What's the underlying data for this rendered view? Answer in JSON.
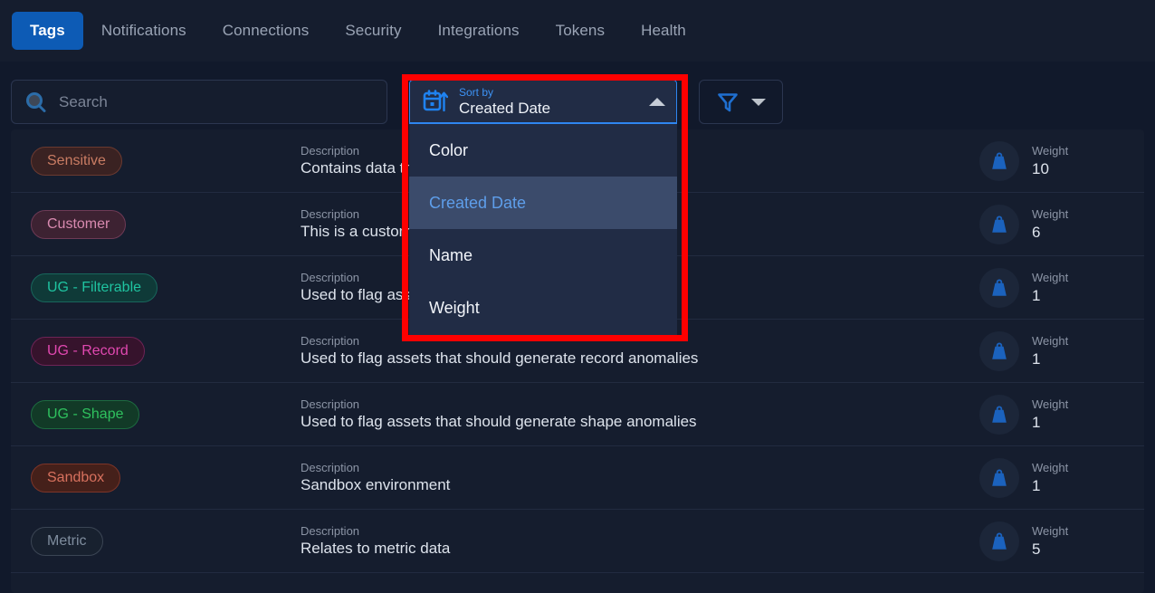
{
  "tabs": [
    {
      "label": "Tags",
      "active": true
    },
    {
      "label": "Notifications",
      "active": false
    },
    {
      "label": "Connections",
      "active": false
    },
    {
      "label": "Security",
      "active": false
    },
    {
      "label": "Integrations",
      "active": false
    },
    {
      "label": "Tokens",
      "active": false
    },
    {
      "label": "Health",
      "active": false
    }
  ],
  "search": {
    "placeholder": "Search",
    "value": ""
  },
  "sort": {
    "caption": "Sort by",
    "value": "Created Date",
    "expanded": true,
    "options": [
      {
        "label": "Color",
        "selected": false
      },
      {
        "label": "Created Date",
        "selected": true
      },
      {
        "label": "Name",
        "selected": false
      },
      {
        "label": "Weight",
        "selected": false
      }
    ]
  },
  "filter": {
    "label": ""
  },
  "columns": {
    "description": "Description",
    "weight": "Weight"
  },
  "rows": [
    {
      "tag": "Sensitive",
      "tag_color": "#c97c63",
      "tag_bg": "#3a2222",
      "tag_border": "#6b3a30",
      "description": "Contains data that requires strict access controls.",
      "weight": "10"
    },
    {
      "tag": "Customer",
      "tag_color": "#d98ab0",
      "tag_bg": "#3d2232",
      "tag_border": "#6d3a55",
      "description": "This is a customer tag",
      "weight": "6"
    },
    {
      "tag": "UG - Filterable",
      "tag_color": "#1fc3a0",
      "tag_bg": "#0f3a38",
      "tag_border": "#18665c",
      "description": "Used to flag assets that should be filterable",
      "weight": "1"
    },
    {
      "tag": "UG - Record",
      "tag_color": "#e048b0",
      "tag_bg": "#36132c",
      "tag_border": "#6e2456",
      "description": "Used to flag assets that should generate record anomalies",
      "weight": "1"
    },
    {
      "tag": "UG - Shape",
      "tag_color": "#2fc15e",
      "tag_bg": "#123a27",
      "tag_border": "#1d6b40",
      "description": "Used to flag assets that should generate shape anomalies",
      "weight": "1"
    },
    {
      "tag": "Sandbox",
      "tag_color": "#d8715e",
      "tag_bg": "#45201a",
      "tag_border": "#7d3528",
      "description": "Sandbox environment",
      "weight": "1"
    },
    {
      "tag": "Metric",
      "tag_color": "#7f8d9e",
      "tag_bg": "#18212f",
      "tag_border": "#3b4554",
      "description": "Relates to metric data",
      "weight": "5"
    }
  ],
  "colors": {
    "accent": "#0d5bb5",
    "accent_light": "#2f86f0",
    "highlight_box": "#fe0000",
    "page_bg": "#11192b",
    "panel_bg": "#151d2e"
  },
  "icons": {
    "search": "search-icon",
    "calendar_sort_asc": "calendar-sort-ascending-icon",
    "caret_up": "chevron-up-icon",
    "funnel": "filter-funnel-icon",
    "caret_down": "chevron-down-icon",
    "weight": "weight-kettlebell-icon"
  }
}
